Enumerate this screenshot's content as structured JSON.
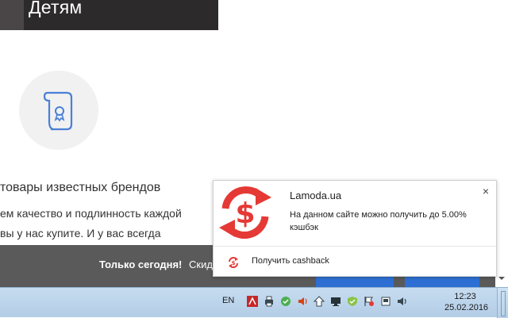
{
  "hero": {
    "title": "Детям"
  },
  "feature": {
    "heading": "товары известных брендов",
    "text_line_1": "ем качество и подлинность каждой",
    "text_line_2": "вы у нас купите. И у вас всегда"
  },
  "promo_bar": {
    "today_label": "Только сегодня!",
    "discount_text": "Скид"
  },
  "notification": {
    "title": "Lamoda.ua",
    "message": "На данном сайте можно получить до 5.00% кэшбэк",
    "close_glyph": "×",
    "action_label": "Получить cashback",
    "brand_color": "#e53935"
  },
  "taskbar": {
    "language": "EN",
    "time": "12:23",
    "date": "25.02.2016",
    "tray_icons": [
      "adobe-icon",
      "printer-icon",
      "network-icon",
      "speaker-icon",
      "upload-icon",
      "monitor-icon",
      "shield-check-icon",
      "flag-error-icon",
      "device-icon",
      "volume-icon"
    ]
  }
}
